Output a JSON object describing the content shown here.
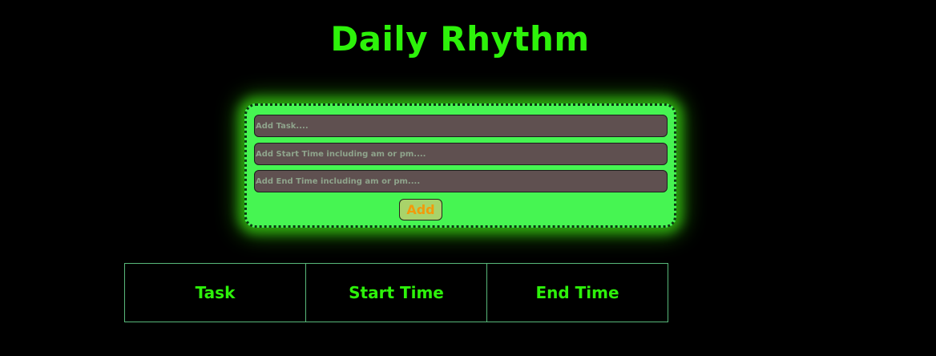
{
  "page": {
    "title": "Daily Rhythm"
  },
  "form": {
    "task_placeholder": "Add Task....",
    "start_placeholder": "Add Start Time including am or pm....",
    "end_placeholder": "Add End Time including am or pm....",
    "add_label": "Add"
  },
  "table": {
    "headers": [
      "Task",
      "Start Time",
      "End Time"
    ],
    "rows": []
  },
  "colors": {
    "background": "#000000",
    "title": "#2df20a",
    "card": "#46f552",
    "input": "#5f5050",
    "button": "#a9d36a",
    "button_text": "#f29a0c",
    "table_border": "#58b87a"
  }
}
